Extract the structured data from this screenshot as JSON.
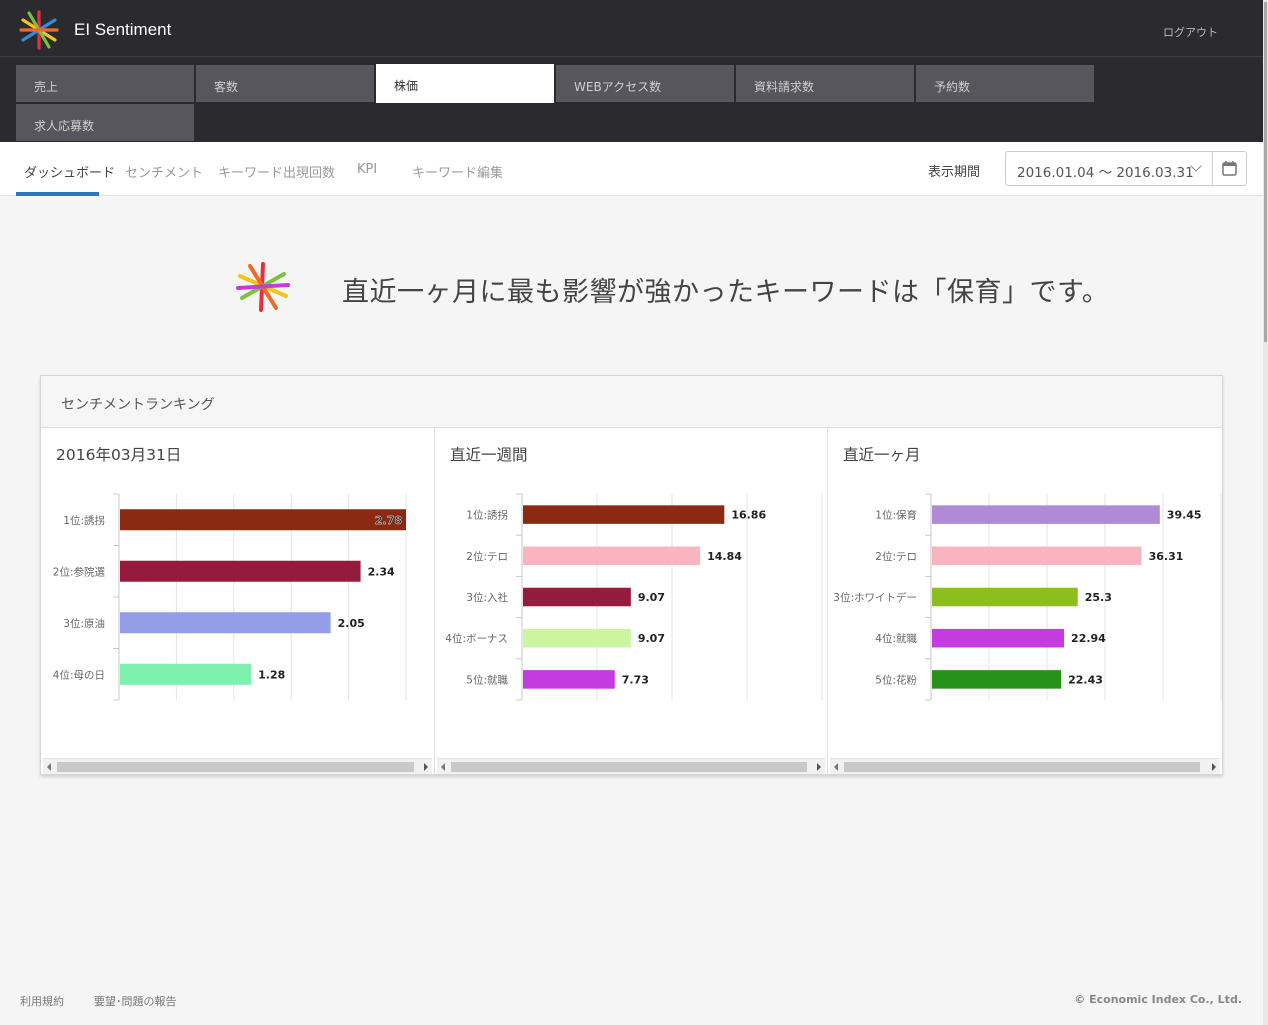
{
  "header": {
    "app_name": "EI Sentiment",
    "logout_label": "ログアウト"
  },
  "categories": [
    {
      "label": "売上",
      "active": false
    },
    {
      "label": "客数",
      "active": false
    },
    {
      "label": "株価",
      "active": true
    },
    {
      "label": "WEBアクセス数",
      "active": false
    },
    {
      "label": "資料請求数",
      "active": false
    },
    {
      "label": "予約数",
      "active": false
    },
    {
      "label": "求人応募数",
      "active": false
    }
  ],
  "subnav": {
    "tabs": [
      {
        "label": "ダッシュボード",
        "active": true
      },
      {
        "label": "センチメント",
        "active": false
      },
      {
        "label": "キーワード出現回数",
        "active": false
      },
      {
        "label": "KPI",
        "active": false
      },
      {
        "label": "キーワード編集",
        "active": false
      }
    ],
    "period_label": "表示期間",
    "period_value": "2016.01.04 ～ 2016.03.31"
  },
  "headline": "直近一ヶ月に最も影響が強かったキーワードは「保育」です。",
  "ranking": {
    "title": "センチメントランキング"
  },
  "chart_data": [
    {
      "type": "bar",
      "orientation": "horizontal",
      "title": "2016年03月31日",
      "categories": [
        "1位:誘拐",
        "2位:参院選",
        "3位:原油",
        "4位:母の日"
      ],
      "values": [
        2.78,
        2.34,
        2.05,
        1.28
      ],
      "value_labels": [
        "2.78",
        "2.34",
        "2.05",
        "1.28"
      ],
      "colors": [
        "#8b2a12",
        "#941b3b",
        "#949ee6",
        "#7df0ad"
      ],
      "xlim": [
        0,
        2.78
      ],
      "grid": true
    },
    {
      "type": "bar",
      "orientation": "horizontal",
      "title": "直近一週間",
      "categories": [
        "1位:誘拐",
        "2位:テロ",
        "3位:入社",
        "4位:ボーナス",
        "5位:就職"
      ],
      "values": [
        16.86,
        14.84,
        9.07,
        9.07,
        7.73
      ],
      "value_labels": [
        "16.86",
        "14.84",
        "9.07",
        "9.07",
        "7.73"
      ],
      "colors": [
        "#8b2a12",
        "#f8b5c0",
        "#941b3b",
        "#cbf59f",
        "#c43ce0"
      ],
      "xlim": [
        0,
        25
      ],
      "grid": true
    },
    {
      "type": "bar",
      "orientation": "horizontal",
      "title": "直近一ヶ月",
      "categories": [
        "1位:保育",
        "2位:テロ",
        "3位:ホワイトデー",
        "4位:就職",
        "5位:花粉"
      ],
      "values": [
        39.45,
        36.31,
        25.3,
        22.94,
        22.43
      ],
      "value_labels": [
        "39.45",
        "36.31",
        "25.3",
        "22.94",
        "22.43"
      ],
      "colors": [
        "#b08ad6",
        "#f8b5c0",
        "#8cbf1e",
        "#c43ce0",
        "#27921a"
      ],
      "xlim": [
        0,
        50
      ],
      "grid": true
    }
  ],
  "footer": {
    "terms_label": "利用規約",
    "report_label": "要望･問題の報告",
    "copyright": "© Economic Index Co., Ltd."
  },
  "colors": {
    "header_bg": "#2b2b2f",
    "tab_bg": "#56565c",
    "accent_underline": "#2a78c2"
  }
}
